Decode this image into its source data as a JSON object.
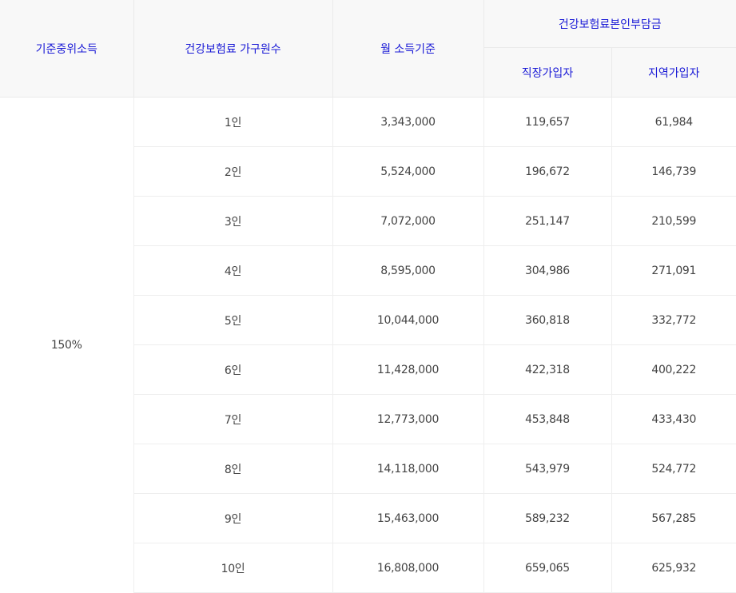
{
  "header": {
    "median_income": "기준중위소득",
    "household_size": "건강보험료 가구원수",
    "monthly_income": "월 소득기준",
    "premium_group": "건강보험료본인부담금",
    "employee": "직장가입자",
    "regional": "지역가입자"
  },
  "rate": "150%",
  "rows": [
    {
      "household": "1인",
      "income": "3,343,000",
      "employee": "119,657",
      "regional": "61,984"
    },
    {
      "household": "2인",
      "income": "5,524,000",
      "employee": "196,672",
      "regional": "146,739"
    },
    {
      "household": "3인",
      "income": "7,072,000",
      "employee": "251,147",
      "regional": "210,599"
    },
    {
      "household": "4인",
      "income": "8,595,000",
      "employee": "304,986",
      "regional": "271,091"
    },
    {
      "household": "5인",
      "income": "10,044,000",
      "employee": "360,818",
      "regional": "332,772"
    },
    {
      "household": "6인",
      "income": "11,428,000",
      "employee": "422,318",
      "regional": "400,222"
    },
    {
      "household": "7인",
      "income": "12,773,000",
      "employee": "453,848",
      "regional": "433,430"
    },
    {
      "household": "8인",
      "income": "14,118,000",
      "employee": "543,979",
      "regional": "524,772"
    },
    {
      "household": "9인",
      "income": "15,463,000",
      "employee": "589,232",
      "regional": "567,285"
    },
    {
      "household": "10인",
      "income": "16,808,000",
      "employee": "659,065",
      "regional": "625,932"
    }
  ]
}
